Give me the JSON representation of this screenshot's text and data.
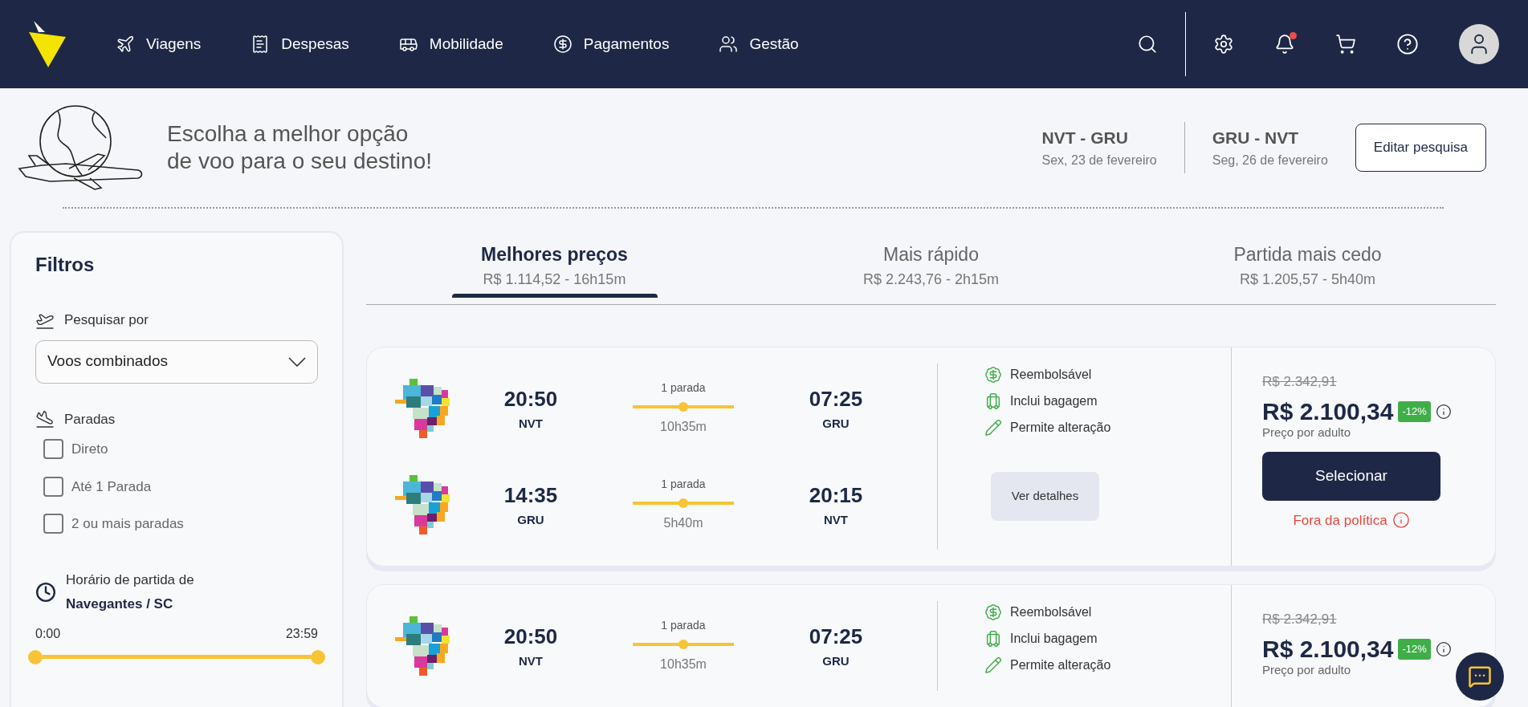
{
  "header": {
    "nav": [
      {
        "kind": "plane",
        "label": "Viagens"
      },
      {
        "kind": "receipt",
        "label": "Despesas"
      },
      {
        "kind": "bus",
        "label": "Mobilidade"
      },
      {
        "kind": "money",
        "label": "Pagamentos"
      },
      {
        "kind": "people",
        "label": "Gestão"
      }
    ],
    "notifications_unread": true
  },
  "hero": {
    "title": "Escolha a melhor opção\nde voo para o seu destino!",
    "routes": [
      {
        "route": "NVT - GRU",
        "date": "Sex, 23 de fevereiro"
      },
      {
        "route": "GRU - NVT",
        "date": "Seg, 26 de fevereiro"
      }
    ],
    "edit_button": "Editar pesquisa"
  },
  "filters": {
    "title": "Filtros",
    "search_by": {
      "label": "Pesquisar por",
      "value": "Voos combinados"
    },
    "stops": {
      "label": "Paradas",
      "options": [
        {
          "label": "Direto",
          "checked": false
        },
        {
          "label": "Até 1 Parada",
          "checked": false
        },
        {
          "label": "2 ou mais paradas",
          "checked": false
        }
      ]
    },
    "departure": {
      "label": "Horário de partida de",
      "place": "Navegantes / SC",
      "min": "0:00",
      "max": "23:59",
      "level": 1
    }
  },
  "tabs": [
    {
      "title": "Melhores preços",
      "subtitle": "R$ 1.114,52 - 16h15m",
      "selected": true
    },
    {
      "title": "Mais rápido",
      "subtitle": "R$ 2.243,76 - 2h15m",
      "selected": false
    },
    {
      "title": "Partida mais cedo",
      "subtitle": "R$ 1.205,57 - 5h40m",
      "selected": false
    }
  ],
  "flights": [
    {
      "legs": [
        {
          "dep_time": "20:50",
          "dep_code": "NVT",
          "stops": "1 parada",
          "duration": "10h35m",
          "arr_time": "07:25",
          "arr_code": "GRU"
        },
        {
          "dep_time": "14:35",
          "dep_code": "GRU",
          "stops": "1 parada",
          "duration": "5h40m",
          "arr_time": "20:15",
          "arr_code": "NVT"
        }
      ],
      "features": [
        {
          "kind": "refund",
          "label": "Reembolsável"
        },
        {
          "kind": "bag",
          "label": "Inclui bagagem"
        },
        {
          "kind": "edit",
          "label": "Permite alteração"
        }
      ],
      "details_button": "Ver detalhes",
      "old_price": "R$ 2.342,91",
      "price": "R$ 2.100,34",
      "discount": "-12%",
      "price_note": "Preço por adulto",
      "select_button": "Selecionar",
      "policy_note": "Fora da política"
    },
    {
      "legs": [
        {
          "dep_time": "20:50",
          "dep_code": "NVT",
          "stops": "1 parada",
          "duration": "10h35m",
          "arr_time": "07:25",
          "arr_code": "GRU"
        }
      ],
      "features": [
        {
          "kind": "refund",
          "label": "Reembolsável"
        },
        {
          "kind": "bag",
          "label": "Inclui bagagem"
        },
        {
          "kind": "edit",
          "label": "Permite alteração"
        }
      ],
      "old_price": "R$ 2.342,91",
      "price": "R$ 2.100,34",
      "discount": "-12%",
      "price_note": "Preço por adulto"
    }
  ]
}
